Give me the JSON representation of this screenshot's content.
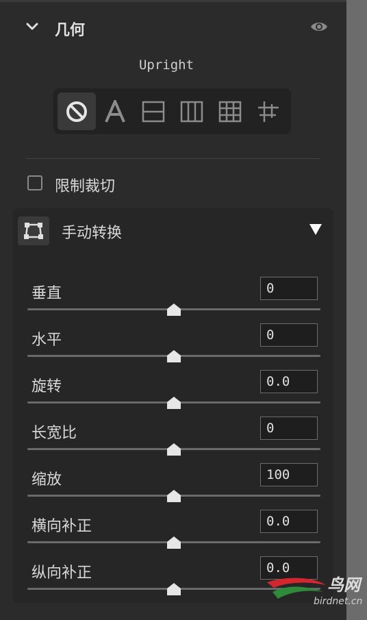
{
  "section": {
    "title": "几何",
    "upright_label": "Upright",
    "upright_modes": [
      {
        "icon": "off-icon",
        "active": true
      },
      {
        "icon": "auto-a-icon",
        "active": false
      },
      {
        "icon": "level-icon",
        "active": false
      },
      {
        "icon": "vertical-icon",
        "active": false
      },
      {
        "icon": "full-grid-icon",
        "active": false
      },
      {
        "icon": "guided-icon",
        "active": false
      }
    ],
    "constrain_crop_label": "限制裁切"
  },
  "manual_transform": {
    "title": "手动转换",
    "sliders": [
      {
        "label": "垂直",
        "value": "0",
        "position": 0.5
      },
      {
        "label": "水平",
        "value": "0",
        "position": 0.5
      },
      {
        "label": "旋转",
        "value": "0.0",
        "position": 0.5
      },
      {
        "label": "长宽比",
        "value": "0",
        "position": 0.5
      },
      {
        "label": "缩放",
        "value": "100",
        "position": 0.5
      },
      {
        "label": "横向补正",
        "value": "0.0",
        "position": 0.5
      },
      {
        "label": "纵向补正",
        "value": "0.0",
        "position": 0.5
      }
    ]
  },
  "watermark": {
    "text": "鸟网",
    "sub": "birdnet.cn"
  },
  "colors": {
    "accent": "#d6d6d6",
    "panel": "#262626",
    "background": "#2b2b2b"
  }
}
